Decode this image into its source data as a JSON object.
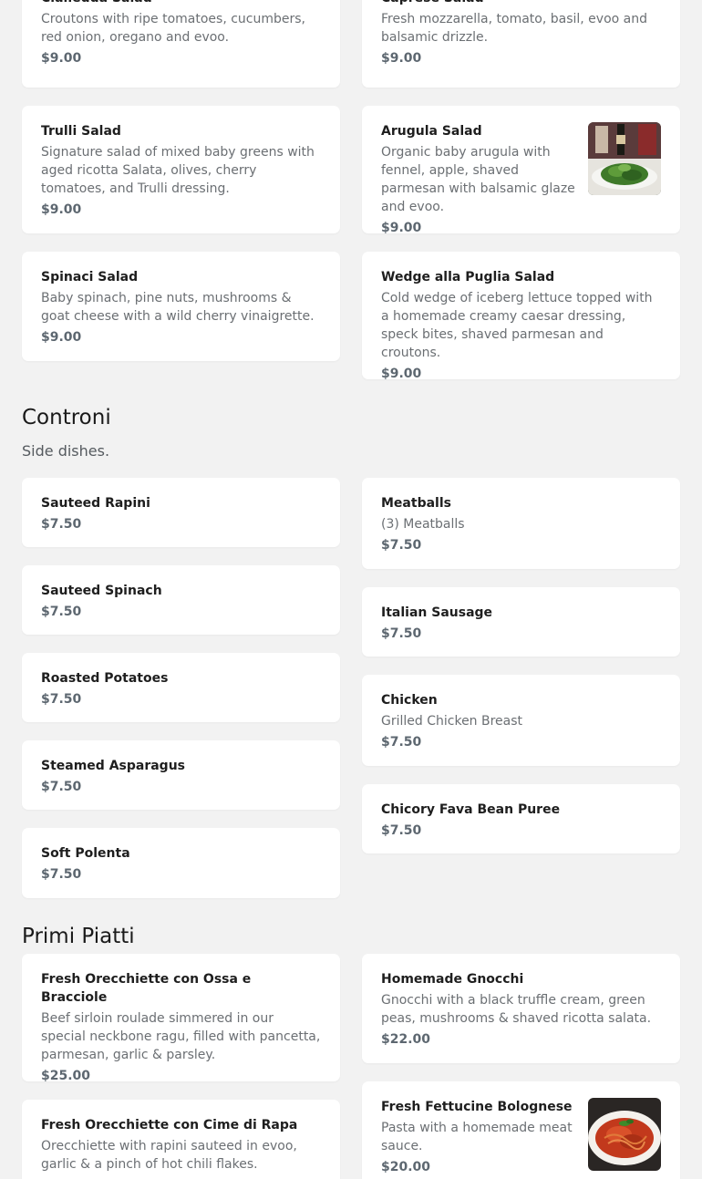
{
  "salads": {
    "items": [
      {
        "name": "Cialledda Salad",
        "desc": "Croutons with ripe tomatoes, cucumbers, red onion, oregano and evoo.",
        "price": "$9.00"
      },
      {
        "name": "Caprese Salad",
        "desc": "Fresh mozzarella, tomato, basil, evoo and balsamic drizzle.",
        "price": "$9.00"
      },
      {
        "name": "Trulli Salad",
        "desc": "Signature salad of mixed baby greens with aged ricotta Salata, olives, cherry tomatoes, and Trulli dressing.",
        "price": "$9.00"
      },
      {
        "name": "Arugula Salad",
        "desc": "Organic baby arugula with fennel, apple, shaved parmesan with balsamic glaze and evoo.",
        "price": "$9.00",
        "image": "arugula-salad-photo"
      },
      {
        "name": "Spinaci Salad",
        "desc": "Baby spinach, pine nuts, mushrooms & goat cheese with a wild cherry vinaigrette.",
        "price": "$9.00"
      },
      {
        "name": "Wedge alla Puglia Salad",
        "desc": "Cold wedge of iceberg lettuce topped with a homemade creamy caesar dressing, speck bites, shaved parmesan and croutons.",
        "price": "$9.00"
      }
    ]
  },
  "contorni": {
    "title": "Controni",
    "subtitle": "Side dishes.",
    "items": [
      {
        "name": "Sauteed Rapini",
        "price": "$7.50"
      },
      {
        "name": "Meatballs",
        "desc": "(3) Meatballs",
        "price": "$7.50"
      },
      {
        "name": "Sauteed Spinach",
        "price": "$7.50"
      },
      {
        "name": "Italian Sausage",
        "price": "$7.50"
      },
      {
        "name": "Roasted Potatoes",
        "price": "$7.50"
      },
      {
        "name": "Chicken",
        "desc": "Grilled Chicken Breast",
        "price": "$7.50"
      },
      {
        "name": "Steamed Asparagus",
        "price": "$7.50"
      },
      {
        "name": "Chicory Fava Bean Puree",
        "price": "$7.50"
      },
      {
        "name": "Soft Polenta",
        "price": "$7.50"
      }
    ]
  },
  "primi": {
    "title": "Primi Piatti",
    "items": [
      {
        "name": "Fresh Orecchiette con Ossa e Bracciole",
        "desc": "Beef sirloin roulade simmered in our special neckbone ragu, filled with pancetta, parmesan, garlic & parsley.",
        "price": "$25.00"
      },
      {
        "name": "Homemade Gnocchi",
        "desc": "Gnocchi with a black truffle cream, green peas, mushrooms & shaved ricotta salata.",
        "price": "$22.00"
      },
      {
        "name": "Fresh Fettucine Bolognese",
        "desc": "Pasta with a homemade meat sauce.",
        "price": "$20.00",
        "image": "bolognese-pasta-photo"
      },
      {
        "name": "Fresh Orecchiette con Cime di Rapa",
        "desc": "Orecchiette with rapini sauteed in evoo, garlic & a pinch of hot chili flakes."
      }
    ]
  }
}
